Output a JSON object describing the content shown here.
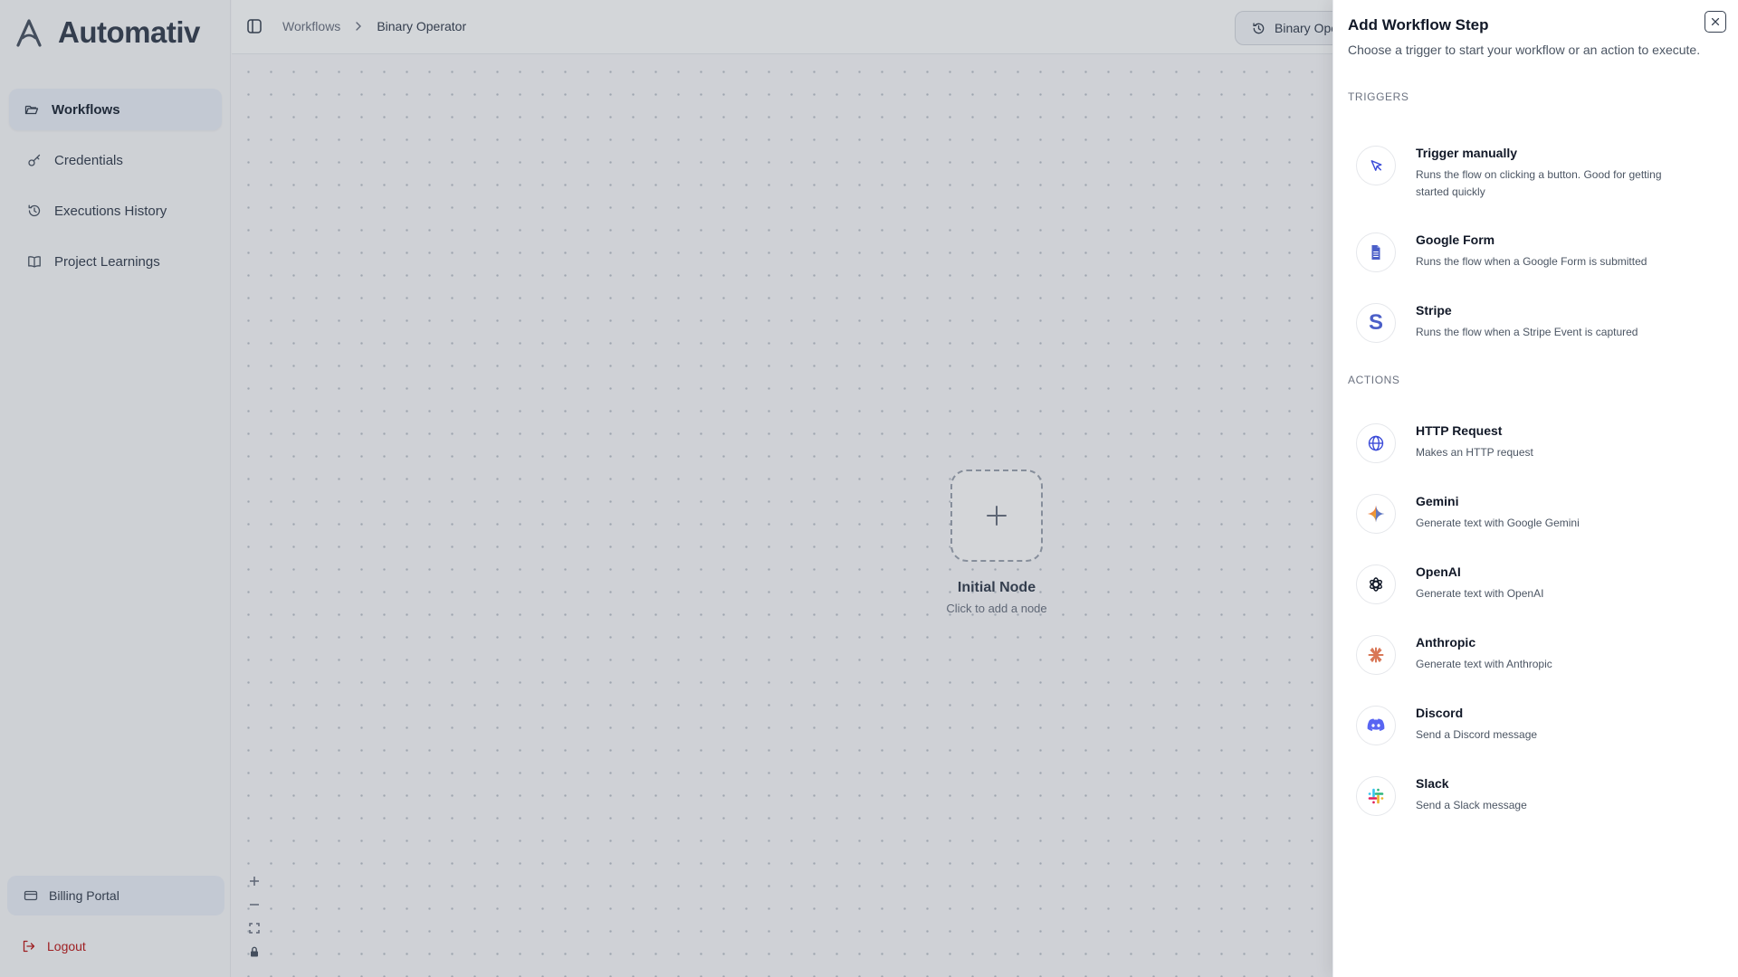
{
  "app": {
    "name": "Automativ"
  },
  "sidebar": {
    "items": [
      {
        "label": "Workflows",
        "icon": "folder-open-icon",
        "active": true
      },
      {
        "label": "Credentials",
        "icon": "key-icon",
        "active": false
      },
      {
        "label": "Executions History",
        "icon": "history-icon",
        "active": false
      },
      {
        "label": "Project Learnings",
        "icon": "book-icon",
        "active": false
      }
    ],
    "billing_label": "Billing Portal",
    "logout_label": "Logout"
  },
  "topbar": {
    "breadcrumb": [
      "Workflows",
      "Binary Operator"
    ],
    "version_label": "Binary Ope"
  },
  "canvas": {
    "node_title": "Initial Node",
    "node_subtitle": "Click to add a node"
  },
  "panel": {
    "title": "Add Workflow Step",
    "subtitle": "Choose a trigger to start your workflow or an action to execute.",
    "triggers_label": "TRIGGERS",
    "actions_label": "ACTIONS",
    "triggers": [
      {
        "title": "Trigger manually",
        "desc": "Runs the flow on clicking a button. Good for getting started quickly",
        "icon": "cursor-icon"
      },
      {
        "title": "Google Form",
        "desc": "Runs the flow when a Google Form is submitted",
        "icon": "google-form-icon"
      },
      {
        "title": "Stripe",
        "desc": "Runs the flow when a Stripe Event is captured",
        "icon": "stripe-icon"
      }
    ],
    "actions": [
      {
        "title": "HTTP Request",
        "desc": "Makes an HTTP request",
        "icon": "globe-icon"
      },
      {
        "title": "Gemini",
        "desc": "Generate text with Google Gemini",
        "icon": "gemini-icon"
      },
      {
        "title": "OpenAI",
        "desc": "Generate text with OpenAI",
        "icon": "openai-icon"
      },
      {
        "title": "Anthropic",
        "desc": "Generate text with Anthropic",
        "icon": "anthropic-icon"
      },
      {
        "title": "Discord",
        "desc": "Send a Discord message",
        "icon": "discord-icon"
      },
      {
        "title": "Slack",
        "desc": "Send a Slack message",
        "icon": "slack-icon"
      }
    ]
  },
  "colors": {
    "accent_active": "#e6ebf3",
    "logout": "#b91c1c",
    "gemini": "#3b6ee8",
    "anthropic": "#d97757",
    "discord": "#5865f2",
    "stripe": "#635bff"
  }
}
